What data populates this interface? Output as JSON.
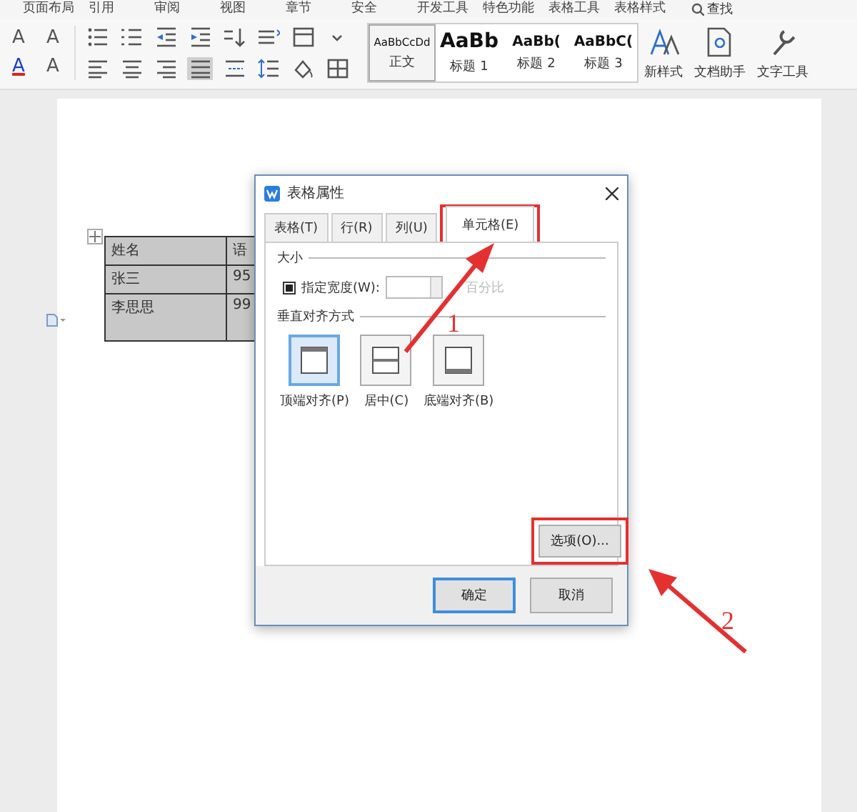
{
  "menu_tabs": [
    {
      "label": "页面布局"
    },
    {
      "label": "引用"
    },
    {
      "label": "审阅"
    },
    {
      "label": "视图"
    },
    {
      "label": "章节"
    },
    {
      "label": "安全"
    },
    {
      "label": "开发工具"
    },
    {
      "label": "特色功能"
    },
    {
      "label": "表格工具"
    },
    {
      "label": "表格样式"
    }
  ],
  "search": {
    "label": "查找"
  },
  "font_buttons": [
    {
      "glyph": "A"
    },
    {
      "glyph": "A"
    },
    {
      "glyph": "A"
    },
    {
      "glyph": "A"
    }
  ],
  "styles": [
    {
      "preview": "AaBbCcDd",
      "label": "正文",
      "selected": true
    },
    {
      "preview": "AaBb",
      "label": "标题 1",
      "selected": false
    },
    {
      "preview": "AaBb(",
      "label": "标题 2",
      "selected": false
    },
    {
      "preview": "AaBbC(",
      "label": "标题 3",
      "selected": false
    }
  ],
  "tools": [
    {
      "label": "新样式"
    },
    {
      "label": "文档助手"
    },
    {
      "label": "文字工具"
    }
  ],
  "table": {
    "rows": [
      [
        "姓名",
        "语"
      ],
      [
        "张三",
        "95"
      ],
      [
        "李思思",
        "99"
      ]
    ]
  },
  "dialog": {
    "title": "表格属性",
    "tabs": [
      {
        "label": "表格(T)",
        "selected": false
      },
      {
        "label": "行(R)",
        "selected": false
      },
      {
        "label": "列(U)",
        "selected": false
      },
      {
        "label": "单元格(E)",
        "selected": true,
        "annotated": true
      }
    ],
    "size_section": "大小",
    "width_checkbox": {
      "label": "指定宽度(W):",
      "checked": true
    },
    "unit": {
      "label": "百分比",
      "disabled": true
    },
    "align_section": "垂直对齐方式",
    "alignments": [
      {
        "label": "顶端对齐(P)",
        "kind": "top",
        "selected": true
      },
      {
        "label": "居中(C)",
        "kind": "middle",
        "selected": false
      },
      {
        "label": "底端对齐(B)",
        "kind": "bottom",
        "selected": false
      }
    ],
    "options_button": {
      "label": "选项(O)...",
      "annotated": true
    },
    "ok_button": "确定",
    "cancel_button": "取消"
  },
  "annotations": [
    {
      "label": "1"
    },
    {
      "label": "2"
    }
  ]
}
